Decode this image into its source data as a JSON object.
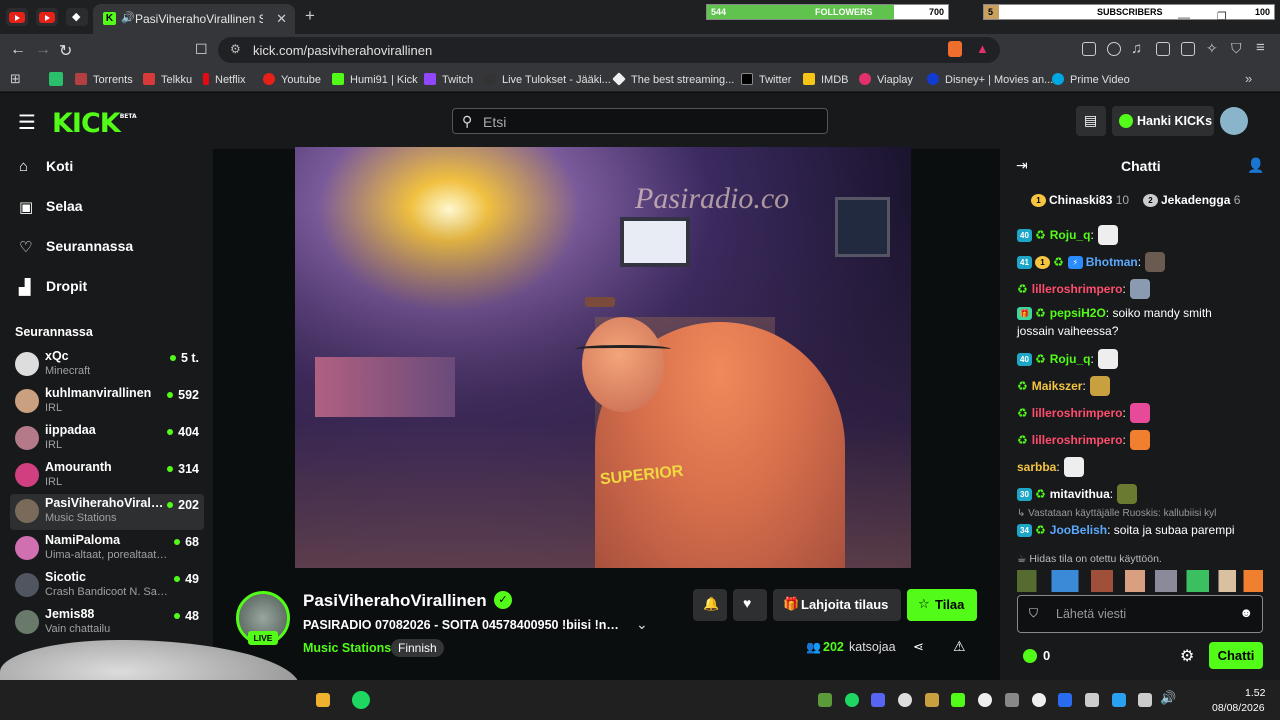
{
  "browser": {
    "active_tab_title": "PasiViherahoVirallinen Stream",
    "url": "kick.com/pasiviherahovirallinen"
  },
  "overlay": {
    "followers_label": "FOLLOWERS",
    "followers_current": "544",
    "followers_goal": "700",
    "followers_progress": 0.777,
    "subscribers_label": "SUBSCRIBERS",
    "subscribers_current": "5",
    "subscribers_goal": "100",
    "subscribers_progress": 0.05
  },
  "bookmarks": [
    "Torrents",
    "Telkku",
    "Netflix",
    "Youtube",
    "Humi91 | Kick",
    "Twitch",
    "Live Tulokset - Jääki...",
    "The best streaming...",
    "Twitter",
    "IMDB",
    "Viaplay",
    "Disney+ | Movies an...",
    "Prime Video"
  ],
  "kick": {
    "logo": "KICK",
    "beta": "BETA",
    "search_placeholder": "Etsi",
    "get_kicks": "Hanki KICKs"
  },
  "sidebar": {
    "nav": [
      "Koti",
      "Selaa",
      "Seurannassa",
      "Dropit"
    ],
    "following_title": "Seurannassa",
    "channels": [
      {
        "name": "xQc",
        "category": "Minecraft",
        "viewers": "5 t."
      },
      {
        "name": "kuhlmanvirallinen",
        "category": "IRL",
        "viewers": "592"
      },
      {
        "name": "iippadaa",
        "category": "IRL",
        "viewers": "404"
      },
      {
        "name": "Amouranth",
        "category": "IRL",
        "viewers": "314"
      },
      {
        "name": "PasiViherahoVirallinen",
        "category": "Music Stations",
        "viewers": "202"
      },
      {
        "name": "NamiPaloma",
        "category": "Uima-altaat, porealtaat ja rannat",
        "viewers": "68"
      },
      {
        "name": "Sicotic",
        "category": "Crash Bandicoot N. Sane Trilogy",
        "viewers": "49"
      },
      {
        "name": "Jemis88",
        "category": "Vain chattailu",
        "viewers": "48"
      }
    ]
  },
  "video": {
    "watermark": "Pasiradio.co"
  },
  "stream": {
    "channel": "PasiViherahoVirallinen",
    "title": "PASIRADIO 07082026 - SOITA 04578400950 !biisi !nuoret",
    "category": "Music Stations",
    "tag": "Finnish",
    "live": "LIVE",
    "gift_button": "Lahjoita tilaus",
    "subscribe_button": "Tilaa",
    "viewers": "202",
    "viewers_label": "katsojaa"
  },
  "chat": {
    "title": "Chatti",
    "top": [
      {
        "rank": "1",
        "name": "Chinaski83",
        "count": "10"
      },
      {
        "rank": "2",
        "name": "Jekadengga",
        "count": "6"
      }
    ],
    "messages": [
      {
        "badges": [
          "40",
          "rec"
        ],
        "user": "Roju_q",
        "color": "#53fc18",
        "text": ""
      },
      {
        "badges": [
          "41",
          "1",
          "rec",
          "bot"
        ],
        "user": "Bhotman",
        "color": "#5aa9ff",
        "text": ""
      },
      {
        "badges": [
          "rec"
        ],
        "user": "lilleroshrimpero",
        "color": "#ff4d6d",
        "text": ""
      },
      {
        "badges": [
          "gift",
          "rec"
        ],
        "user": "pepsiH2O",
        "color": "#53fc18",
        "text": "soiko mandy smith",
        "text2": "jossain vaiheessa?"
      },
      {
        "badges": [
          "40",
          "rec"
        ],
        "user": "Roju_q",
        "color": "#53fc18",
        "text": ""
      },
      {
        "badges": [
          "rec"
        ],
        "user": "Maikszer",
        "color": "#f5c542",
        "text": ""
      },
      {
        "badges": [
          "rec"
        ],
        "user": "lilleroshrimpero",
        "color": "#ff4d6d",
        "text": ""
      },
      {
        "badges": [
          "rec"
        ],
        "user": "lilleroshrimpero",
        "color": "#ff4d6d",
        "text": ""
      },
      {
        "badges": [],
        "user": "sarbba",
        "color": "#f5c542",
        "text": ""
      },
      {
        "badges": [
          "30",
          "rec"
        ],
        "user": "mitavithua",
        "color": "#ffffff",
        "text": ""
      },
      {
        "badges": [
          "34",
          "rec"
        ],
        "user": "JooBelish",
        "color": "#5aa9ff",
        "text": "soita ja subaa parempi",
        "reply": "Vastataan käyttäjälle Ruoskis: kallubiisi kyl"
      }
    ],
    "slow_mode": "Hidas tila on otettu käyttöön.",
    "input_placeholder": "Lähetä viesti",
    "kicks": "0",
    "send": "Chatti"
  },
  "taskbar": {
    "time": "1.52",
    "date": "08/08/2026"
  }
}
